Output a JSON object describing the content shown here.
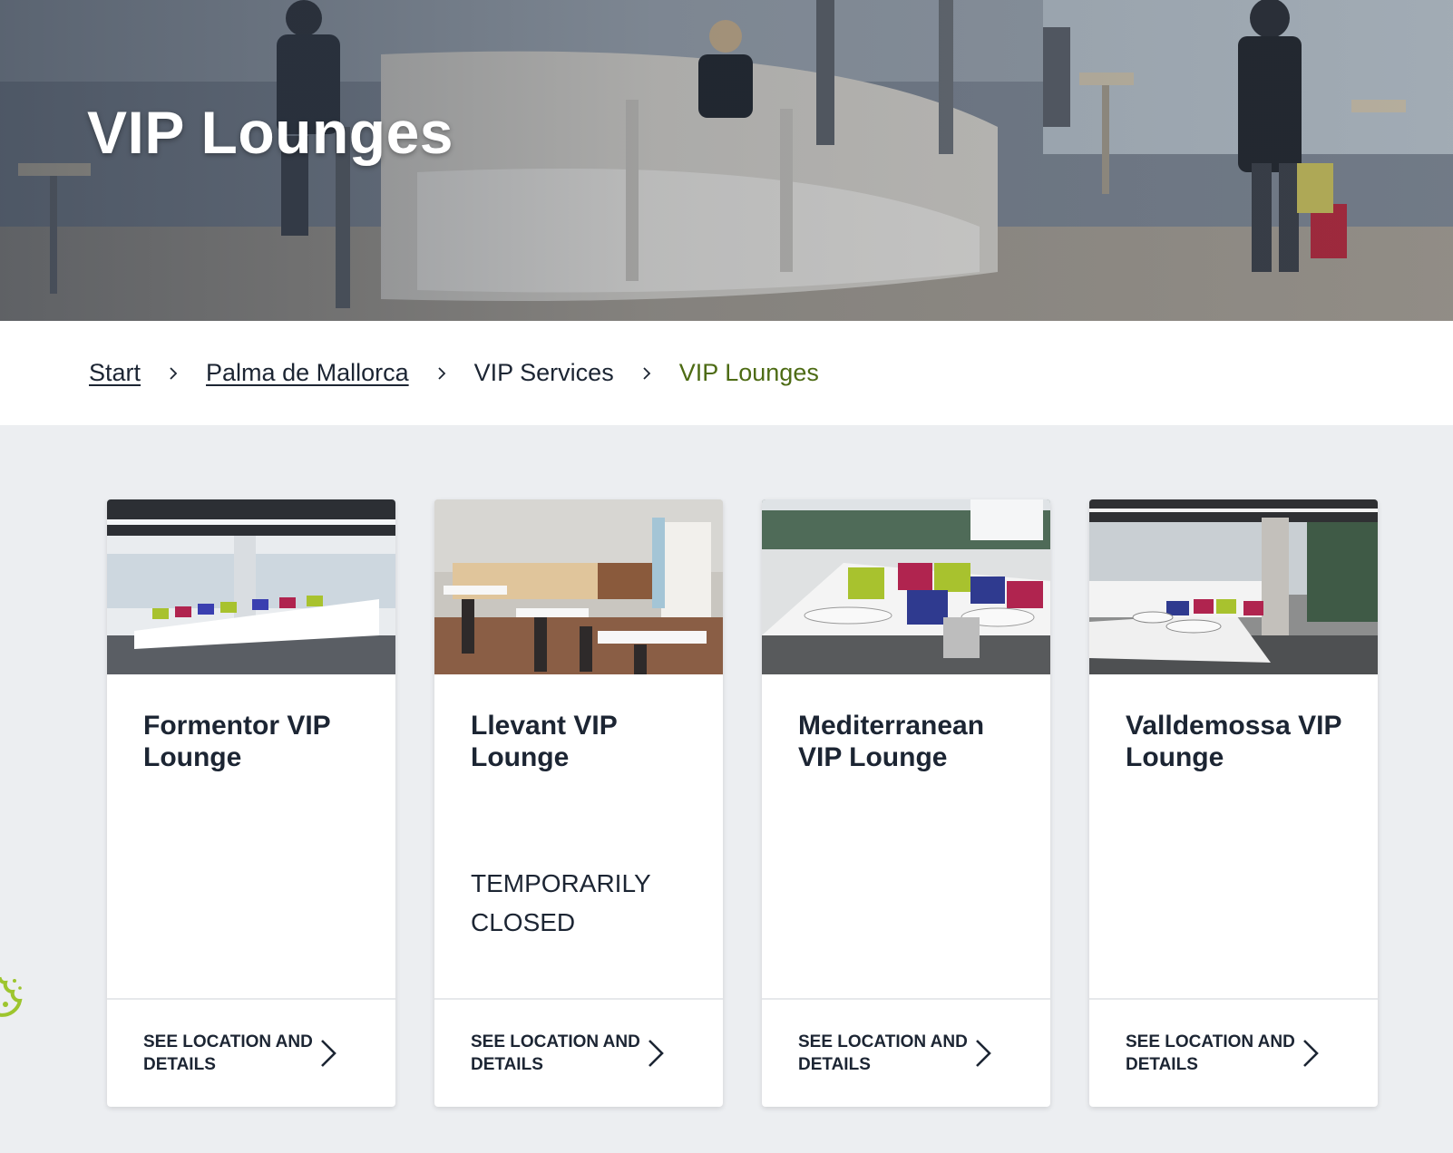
{
  "hero": {
    "title": "VIP Lounges"
  },
  "breadcrumb": {
    "items": [
      {
        "label": "Start"
      },
      {
        "label": "Palma de Mallorca"
      },
      {
        "label": "VIP Services"
      },
      {
        "label": "VIP Lounges"
      }
    ]
  },
  "lounges": [
    {
      "title": "Formentor VIP Lounge",
      "status": "",
      "link_label": "SEE LOCATION AND DETAILS"
    },
    {
      "title": "Llevant VIP Lounge",
      "status": "TEMPORARILY CLOSED",
      "link_label": "SEE LOCATION AND DETAILS"
    },
    {
      "title": "Mediterranean VIP Lounge",
      "status": "",
      "link_label": "SEE LOCATION AND DETAILS"
    },
    {
      "title": "Valldemossa VIP Lounge",
      "status": "",
      "link_label": "SEE LOCATION AND DETAILS"
    }
  ],
  "icons": {
    "breadcrumb_separator": "chevron-right-icon",
    "card_link": "chevron-right-icon",
    "cookie": "cookie-icon"
  },
  "colors": {
    "breadcrumb_current": "#4d6b14",
    "page_background": "#eceef1",
    "text": "#1c2533",
    "cookie_icon": "#9dc52e"
  }
}
